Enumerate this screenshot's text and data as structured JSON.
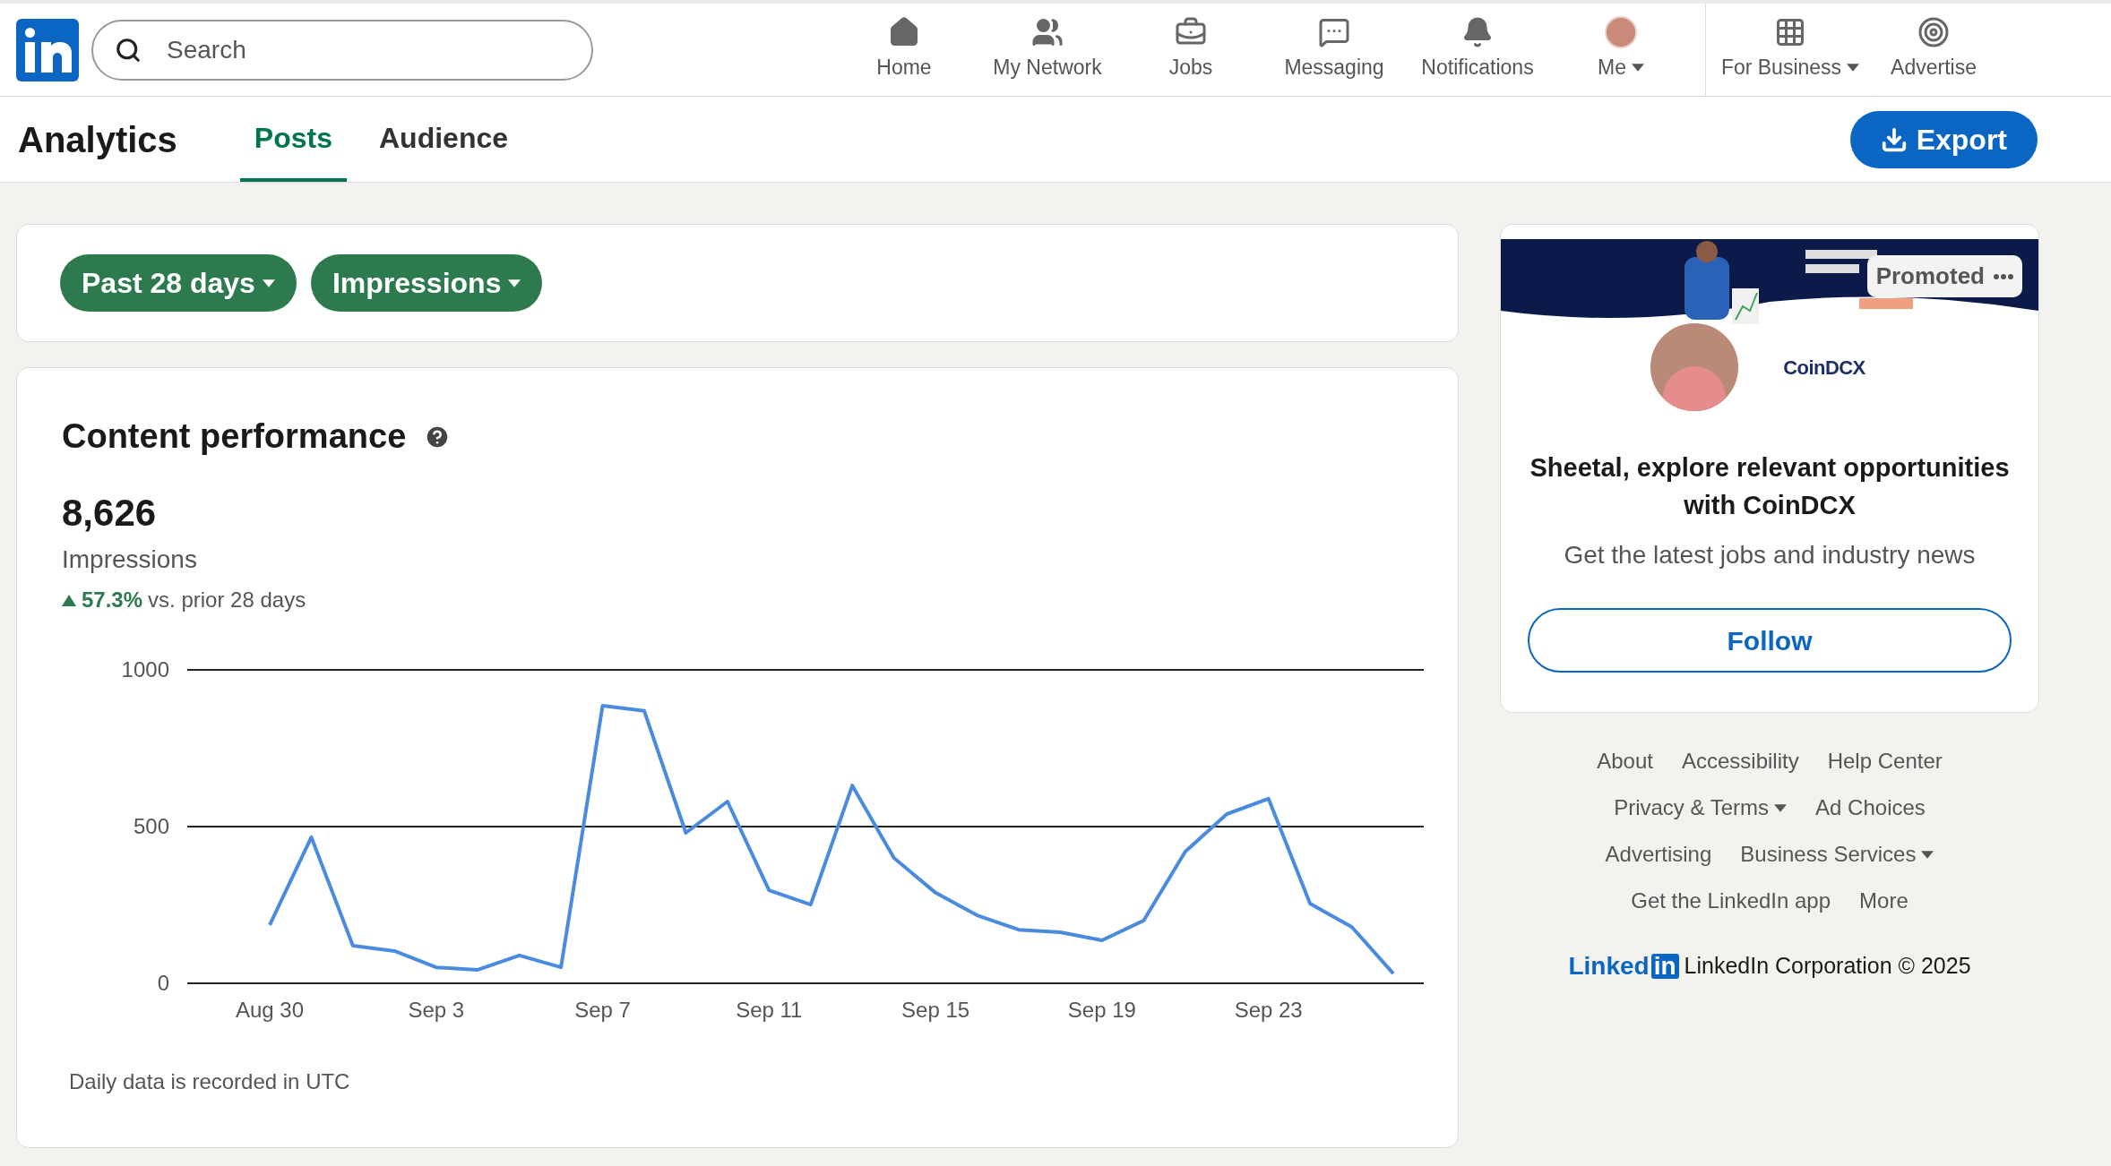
{
  "nav": {
    "search": {
      "placeholder": "Search"
    },
    "items": [
      {
        "label": "Home",
        "kind": "home",
        "caret": false
      },
      {
        "label": "My Network",
        "kind": "network",
        "caret": false
      },
      {
        "label": "Jobs",
        "kind": "jobs",
        "caret": false
      },
      {
        "label": "Messaging",
        "kind": "messaging",
        "caret": false
      },
      {
        "label": "Notifications",
        "kind": "notifications",
        "caret": false
      },
      {
        "label": "Me",
        "kind": "me",
        "caret": true
      }
    ],
    "business": [
      {
        "label": "For Business",
        "kind": "grid",
        "caret": true
      },
      {
        "label": "Advertise",
        "kind": "advertise",
        "caret": false
      }
    ]
  },
  "subheader": {
    "title": "Analytics",
    "tabs": [
      {
        "label": "Posts",
        "selected": true
      },
      {
        "label": "Audience",
        "selected": false
      }
    ],
    "export_button": "Export"
  },
  "filters": [
    "Past 28 days",
    "Impressions"
  ],
  "content_performance": {
    "title": "Content performance",
    "total": "8,626",
    "metric": "Impressions",
    "change": "57.3%",
    "change_suffix": "vs. prior 28 days",
    "footnote": "Daily data is recorded in UTC",
    "chart_data": {
      "type": "line",
      "categories": [
        "Aug 30",
        null,
        null,
        null,
        "Sep 3",
        null,
        null,
        null,
        "Sep 7",
        null,
        null,
        null,
        "Sep 11",
        null,
        null,
        null,
        "Sep 15",
        null,
        null,
        null,
        "Sep 19",
        null,
        null,
        null,
        "Sep 23",
        null,
        null,
        null
      ],
      "series": [
        {
          "color": "#4a8be0",
          "values": [
            186,
            466,
            120,
            103,
            51,
            43,
            89,
            51,
            886,
            869,
            480,
            580,
            297,
            251,
            631,
            400,
            289,
            217,
            171,
            163,
            137,
            200,
            420,
            540,
            589,
            254,
            180,
            31
          ]
        }
      ],
      "ylim": [
        0,
        1000
      ],
      "yticks": [
        0,
        500,
        1000
      ]
    }
  },
  "ad": {
    "badge": "Promoted",
    "company_logo": "CoinDCX",
    "headline": "Sheetal, explore relevant opportunities with CoinDCX",
    "subtext": "Get the latest jobs and industry news",
    "button": "Follow"
  },
  "footer": {
    "links": [
      [
        {
          "label": "About",
          "caret": false
        },
        {
          "label": "Accessibility",
          "caret": false
        },
        {
          "label": "Help Center",
          "caret": false
        }
      ],
      [
        {
          "label": "Privacy & Terms",
          "caret": true
        },
        {
          "label": "Ad Choices",
          "caret": false
        }
      ],
      [
        {
          "label": "Advertising",
          "caret": false
        },
        {
          "label": "Business Services",
          "caret": true
        }
      ],
      [
        {
          "label": "Get the LinkedIn app",
          "caret": false
        },
        {
          "label": "More",
          "caret": false
        }
      ]
    ],
    "brand": "Linked",
    "brand_in": "in",
    "copyright": "LinkedIn Corporation © 2025"
  }
}
